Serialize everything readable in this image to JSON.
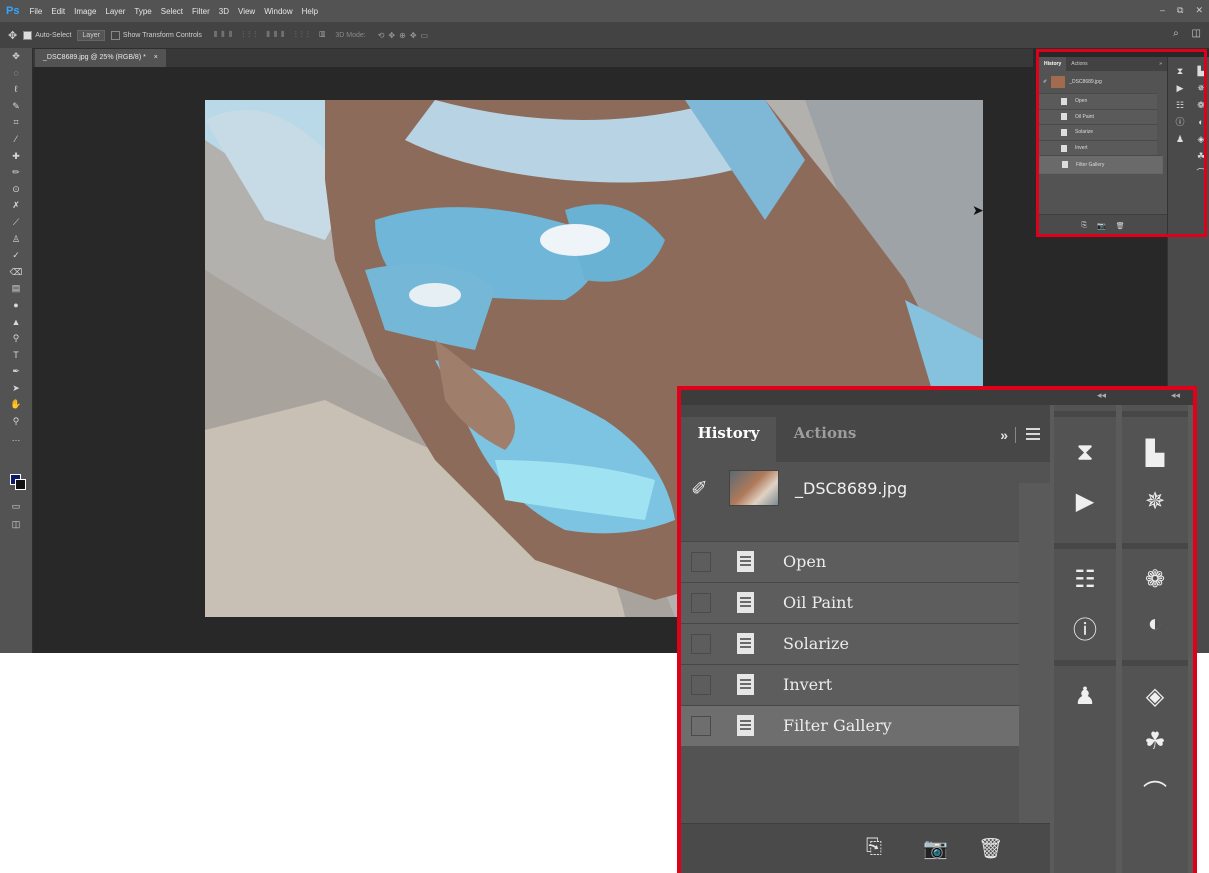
{
  "app": {
    "logo": "Ps",
    "menu": [
      "File",
      "Edit",
      "Image",
      "Layer",
      "Type",
      "Select",
      "Filter",
      "3D",
      "View",
      "Window",
      "Help"
    ],
    "window_controls": [
      "–",
      "⧉",
      "✕"
    ]
  },
  "options_bar": {
    "move_icon": "✥",
    "auto_select_label": "Auto-Select",
    "auto_select_target": "Layer",
    "show_transform_label": "Show Transform Controls",
    "mode_label": "3D Mode:",
    "search_glyph": "⌕",
    "workspace_glyph": "◫"
  },
  "document": {
    "tab_title": "_DSC8689.jpg @ 25% (RGB/8) *",
    "close_glyph": "×"
  },
  "history_panel": {
    "tabs": {
      "history": "History",
      "actions": "Actions"
    },
    "more_glyph": "»",
    "snapshot_name": "_DSC8689.jpg",
    "brush_glyph": "✐",
    "states": [
      {
        "label": "Open",
        "selected": false
      },
      {
        "label": "Oil Paint",
        "selected": false
      },
      {
        "label": "Solarize",
        "selected": false
      },
      {
        "label": "Invert",
        "selected": false
      },
      {
        "label": "Filter Gallery",
        "selected": true
      }
    ],
    "footer_icons": {
      "new_document": "⎘",
      "snapshot": "📷",
      "trash": "🗑"
    }
  },
  "dock_icons": {
    "column1": [
      {
        "name": "history-icon",
        "glyph": "⧗"
      },
      {
        "name": "play-actions-icon",
        "glyph": "▶"
      },
      {
        "name": "properties-icon",
        "glyph": "☷"
      },
      {
        "name": "info-icon",
        "glyph": "ⓘ"
      },
      {
        "name": "clone-source-icon",
        "glyph": "♟"
      }
    ],
    "column2": [
      {
        "name": "histogram-icon",
        "glyph": "▙"
      },
      {
        "name": "navigator-icon",
        "glyph": "✵"
      },
      {
        "name": "libraries-icon",
        "glyph": "❁"
      },
      {
        "name": "adjustments-icon",
        "glyph": "◐"
      },
      {
        "name": "layers-icon",
        "glyph": "◈"
      },
      {
        "name": "channels-icon",
        "glyph": "☘"
      },
      {
        "name": "paths-icon",
        "glyph": "⌒"
      }
    ]
  },
  "colors": {
    "highlight": "#e1001a",
    "ps_blue": "#31a8ff",
    "panel_bg": "#535353",
    "foreground_swatch": "#0b1a6b",
    "background_swatch": "#111111"
  }
}
